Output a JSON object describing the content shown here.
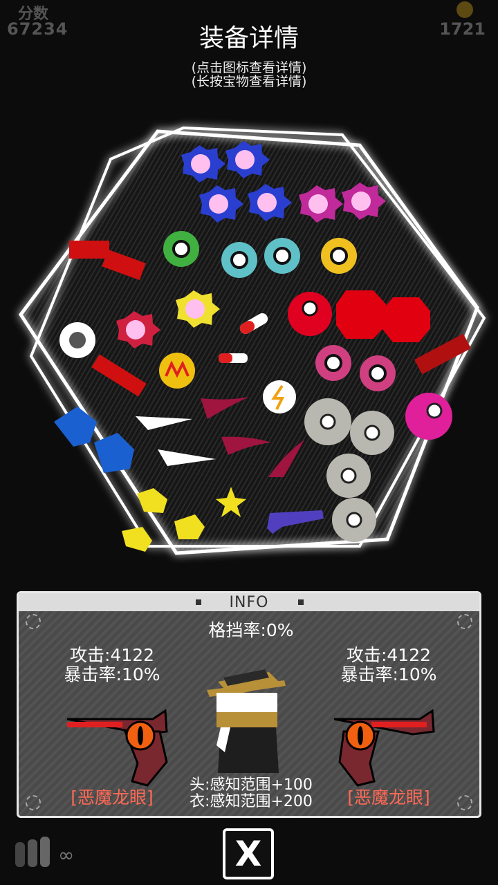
{
  "hud": {
    "score_label": "分数",
    "score": "67234",
    "coins": "1721",
    "ammo": "∞"
  },
  "dialog": {
    "title": "装备详情",
    "hint_tap": "(点击图标查看详情)",
    "hint_hold": "(长按宝物查看详情)"
  },
  "info": {
    "header": "INFO",
    "block_rate": "格挡率:0%",
    "left": {
      "attack": "攻击:4122",
      "crit": "暴击率:10%",
      "weapon": "[恶魔龙眼]"
    },
    "right": {
      "attack": "攻击:4122",
      "crit": "暴击率:10%",
      "weapon": "[恶魔龙眼]"
    },
    "head_bonus": "头:感知范围+100",
    "body_bonus": "衣:感知范围+200"
  },
  "close_label": "X",
  "colors": {
    "accent_red": "#e00010",
    "weapon_name": "#ff6a55",
    "panel_bg": "#4a4a4a",
    "hex_glow": "#ffffff"
  },
  "icons": [
    "coin-icon",
    "flower-gem-icon",
    "ring-gem-icon",
    "red-pill-icon",
    "bullet-icon",
    "blue-boot-icon",
    "star-icon",
    "lightning-coin-icon",
    "gear-ring-icon",
    "claw-icon",
    "demon-gun-icon",
    "ammo-icon",
    "close-icon"
  ]
}
